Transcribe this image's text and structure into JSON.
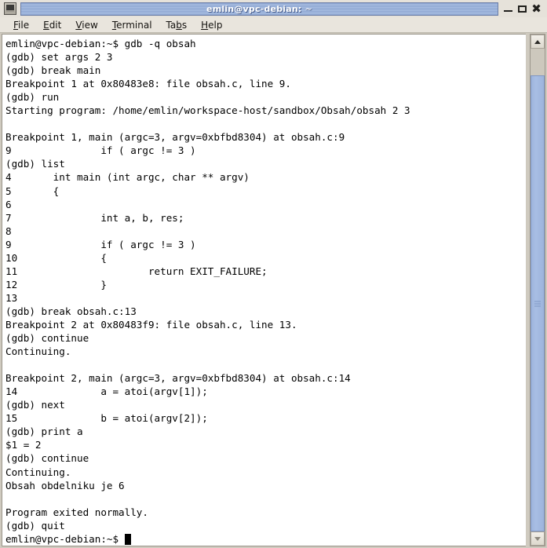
{
  "window": {
    "title": "emlin@vpc-debian: ~",
    "app_icon": "terminal-icon",
    "controls": {
      "minimize": "–",
      "maximize": "□",
      "close": "✖"
    }
  },
  "menubar": {
    "items": [
      {
        "label": "File",
        "mnemonic": "F",
        "before": "",
        "after": "ile"
      },
      {
        "label": "Edit",
        "mnemonic": "E",
        "before": "",
        "after": "dit"
      },
      {
        "label": "View",
        "mnemonic": "V",
        "before": "",
        "after": "iew"
      },
      {
        "label": "Terminal",
        "mnemonic": "T",
        "before": "",
        "after": "erminal"
      },
      {
        "label": "Tabs",
        "mnemonic": "b",
        "before": "Ta",
        "after": "s"
      },
      {
        "label": "Help",
        "mnemonic": "H",
        "before": "",
        "after": "elp"
      }
    ]
  },
  "terminal": {
    "prompt": "emlin@vpc-debian:~$",
    "cursor": "block",
    "lines": [
      "emlin@vpc-debian:~$ gdb -q obsah",
      "(gdb) set args 2 3",
      "(gdb) break main",
      "Breakpoint 1 at 0x80483e8: file obsah.c, line 9.",
      "(gdb) run",
      "Starting program: /home/emlin/workspace-host/sandbox/Obsah/obsah 2 3",
      "",
      "Breakpoint 1, main (argc=3, argv=0xbfbd8304) at obsah.c:9",
      "9               if ( argc != 3 )",
      "(gdb) list",
      "4       int main (int argc, char ** argv)",
      "5       {",
      "6",
      "7               int a, b, res;",
      "8",
      "9               if ( argc != 3 )",
      "10              {",
      "11                      return EXIT_FAILURE;",
      "12              }",
      "13",
      "(gdb) break obsah.c:13",
      "Breakpoint 2 at 0x80483f9: file obsah.c, line 13.",
      "(gdb) continue",
      "Continuing.",
      "",
      "Breakpoint 2, main (argc=3, argv=0xbfbd8304) at obsah.c:14",
      "14              a = atoi(argv[1]);",
      "(gdb) next",
      "15              b = atoi(argv[2]);",
      "(gdb) print a",
      "$1 = 2",
      "(gdb) continue",
      "Continuing.",
      "Obsah obdelniku je 6",
      "",
      "Program exited normally.",
      "(gdb) quit"
    ],
    "last_line": "emlin@vpc-debian:~$ "
  },
  "scrollbar": {
    "up_arrow": "scroll-up-arrow",
    "down_arrow": "scroll-down-arrow",
    "thumb": "scroll-thumb"
  },
  "colors": {
    "titlebar_blue": "#8ea6d2",
    "thumb_blue": "#9db4dc",
    "chrome_gray": "#e9e5dd",
    "terminal_bg": "#ffffff",
    "terminal_fg": "#000000"
  }
}
